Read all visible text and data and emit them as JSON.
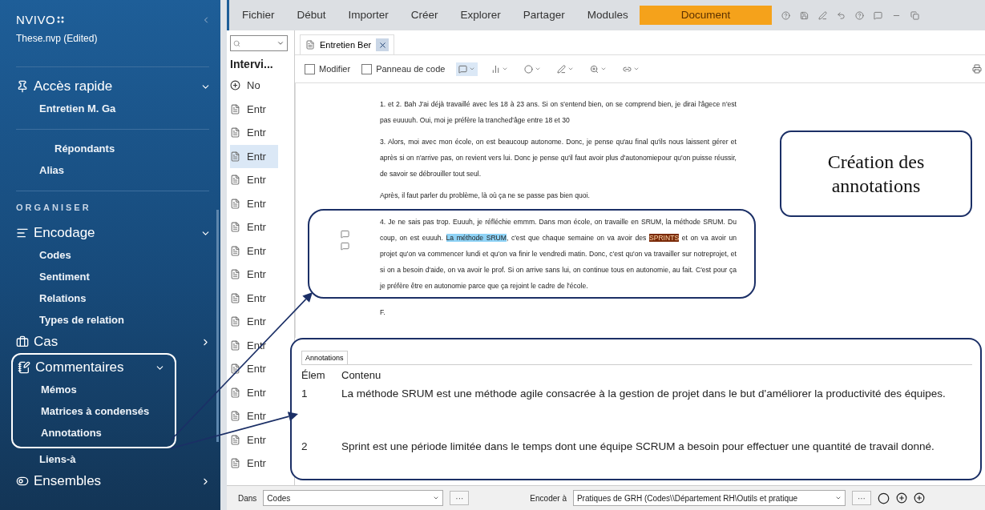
{
  "sidebar": {
    "brand": "NVIVO",
    "project": "These.nvp (Edited)",
    "sections": [
      {
        "kind": "group",
        "title": "Accès rapide",
        "expanded": true,
        "outlined": false,
        "items": [
          "Entretien M. Ga"
        ]
      },
      {
        "kind": "divider"
      },
      {
        "kind": "list",
        "items": [
          {
            "label": "Répondants",
            "indented": true
          },
          {
            "label": "Alias",
            "indented": false
          }
        ]
      },
      {
        "kind": "divider"
      },
      {
        "kind": "caption",
        "title": "ORGANISER"
      },
      {
        "kind": "group",
        "title": "Encodage",
        "expanded": true,
        "outlined": false,
        "items": [
          "Codes",
          "Sentiment",
          "Relations",
          "Types de relation"
        ]
      },
      {
        "kind": "group",
        "title": "Cas",
        "expanded": false,
        "outlined": false
      },
      {
        "kind": "group",
        "title": "Commentaires",
        "expanded": true,
        "outlined": true,
        "items": [
          "Mémos",
          "Matrices à condensés",
          "Annotations"
        ]
      },
      {
        "kind": "list",
        "items": [
          {
            "label": "Liens-à",
            "indented": false
          }
        ]
      },
      {
        "kind": "group",
        "title": "Ensembles",
        "expanded": false,
        "outlined": false
      }
    ]
  },
  "menu": [
    {
      "label": "Fichier",
      "selected": false
    },
    {
      "label": "Début",
      "selected": false
    },
    {
      "label": "Importer",
      "selected": false
    },
    {
      "label": "Créer",
      "selected": false
    },
    {
      "label": "Explorer",
      "selected": false
    },
    {
      "label": "Partager",
      "selected": false
    },
    {
      "label": "Modules",
      "selected": false
    },
    {
      "label": "Document",
      "selected": true
    }
  ],
  "list_pane": {
    "title": "Intervi...",
    "items": [
      {
        "kind": "new",
        "label": "No"
      },
      {
        "kind": "doc",
        "label": "Entr",
        "selected": false
      },
      {
        "kind": "doc",
        "label": "Entr",
        "selected": false
      },
      {
        "kind": "doc",
        "label": "Entr",
        "selected": true
      },
      {
        "kind": "doc",
        "label": "Entr",
        "selected": false
      },
      {
        "kind": "doc",
        "label": "Entr",
        "selected": false
      },
      {
        "kind": "doc",
        "label": "Entr",
        "selected": false
      },
      {
        "kind": "doc",
        "label": "Entr",
        "selected": false
      },
      {
        "kind": "doc",
        "label": "Entr",
        "selected": false
      },
      {
        "kind": "doc",
        "label": "Entr",
        "selected": false
      },
      {
        "kind": "doc",
        "label": "Entr",
        "selected": false
      },
      {
        "kind": "doc",
        "label": "Entr",
        "selected": false
      },
      {
        "kind": "doc",
        "label": "Entr",
        "selected": false
      },
      {
        "kind": "doc",
        "label": "Entr",
        "selected": false
      },
      {
        "kind": "doc",
        "label": "Entr",
        "selected": false
      },
      {
        "kind": "doc",
        "label": "Entr",
        "selected": false
      },
      {
        "kind": "doc",
        "label": "Entr",
        "selected": false
      }
    ]
  },
  "doc_tab": {
    "label": "Entretien Ber"
  },
  "toolbar": {
    "checkboxes": [
      {
        "label": "Modifier",
        "checked": false
      },
      {
        "label": "Panneau de code",
        "checked": false
      }
    ]
  },
  "document": {
    "paragraphs": [
      {
        "outlined": false,
        "segments": [
          {
            "text": "1. et 2. Bah J'ai déjà travaillé avec les 18 à 23 ans. Si on s'entend bien, on se comprend bien, je dirai l'âgece n'est pas euuuuh. Oui, moi je préfère la tranched'âge entre 18 et 30"
          }
        ]
      },
      {
        "outlined": false,
        "segments": [
          {
            "text": "3. Alors, moi avec mon école, on est beaucoup autonome. Donc, je pense qu'au final qu'ils nous laissent gérer et après si on n'arrive pas, on revient vers lui. Donc je pense qu'il faut avoir plus d'autonomiepour qu'on puisse réussir, de savoir se débrouiller tout seul."
          }
        ]
      },
      {
        "outlined": false,
        "segments": [
          {
            "text": "Après, il faut parler du problème, là où ça ne se passe pas bien quoi."
          }
        ]
      },
      {
        "outlined": true,
        "segments": [
          {
            "text": "4. Je ne sais pas trop. Euuuh, je réfléchie emmm. Dans mon école, on travaille en SRUM, la méthode SRUM. Du coup, on est euuuh. "
          },
          {
            "text": "La méthode SRUM",
            "color": "#8fd3f6"
          },
          {
            "text": ", c'est que chaque semaine on va avoir des "
          },
          {
            "text": "SPRINTS",
            "color": "#7a2a08"
          },
          {
            "text": " et on va avoir un projet qu'on va commencer lundi et qu'on va finir le vendredi matin. Donc, c'est qu'on va travailler sur notreprojet, et si on a besoin d'aide, on va avoir le prof. Si on arrive sans lui, on continue tous en autonomie, au fait. C'est pour ça je préfère être en autonomie parce que ça rejoint le cadre de l'école."
          }
        ]
      },
      {
        "outlined": false,
        "segments": [
          {
            "text": "F."
          }
        ]
      }
    ]
  },
  "callout": {
    "text": "Création des annotations"
  },
  "annotations": {
    "tab": "Annotations",
    "outlined": true,
    "columns": [
      "Élem",
      "Contenu"
    ],
    "rows": [
      {
        "item": "1",
        "content": "La méthode SRUM est une méthode agile consacrée à la gestion de projet dans le but d'améliorer la productivité des équipes."
      },
      {
        "item": "2",
        "content": "Sprint est une période limitée dans le temps dont une équipe SCRUM a besoin pour effectuer une quantité de travail donné."
      }
    ]
  },
  "bottom_bar": {
    "in_label": "Dans",
    "in_value": "Codes",
    "code_label": "Encoder à",
    "code_value": "Pratiques de GRH (Codes\\\\Département RH\\Outils et pratique",
    "more": "···"
  }
}
